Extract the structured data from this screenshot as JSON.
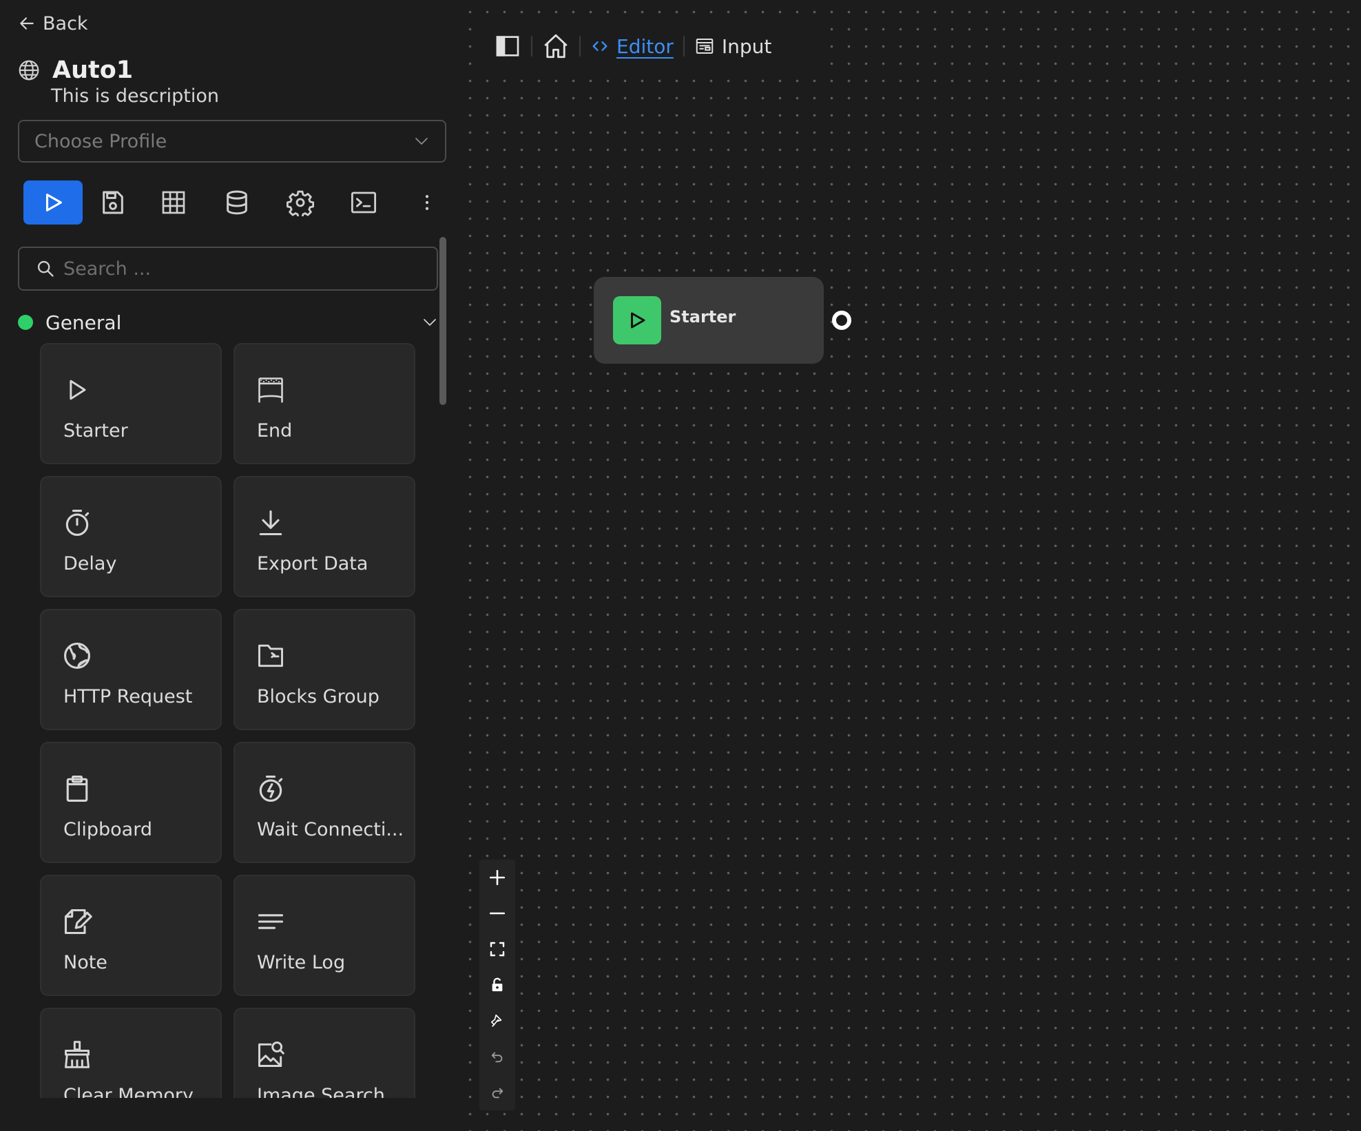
{
  "sidebar": {
    "back_label": "Back",
    "workflow": {
      "title": "Auto1",
      "description": "This is description",
      "icon": "globe-icon"
    },
    "profile_select": {
      "placeholder": "Choose Profile",
      "value": ""
    },
    "toolbar": {
      "items": [
        {
          "name": "run",
          "icon": "play-icon",
          "active": true
        },
        {
          "name": "save",
          "icon": "save-icon"
        },
        {
          "name": "table",
          "icon": "table-icon"
        },
        {
          "name": "storage",
          "icon": "database-icon"
        },
        {
          "name": "settings",
          "icon": "gear-icon"
        },
        {
          "name": "terminal",
          "icon": "terminal-icon"
        },
        {
          "name": "more",
          "icon": "more-vertical-icon"
        }
      ],
      "accent_color": "#1f6de8"
    },
    "search": {
      "placeholder": "Search ...",
      "value": ""
    },
    "category": {
      "label": "General",
      "dot_color": "#2fcf6a",
      "expanded": true,
      "blocks": [
        {
          "label": "Starter",
          "icon": "play-icon"
        },
        {
          "label": "End",
          "icon": "flag-icon"
        },
        {
          "label": "Delay",
          "icon": "stopwatch-icon"
        },
        {
          "label": "Export Data",
          "icon": "download-icon"
        },
        {
          "label": "HTTP Request",
          "icon": "globe-icon"
        },
        {
          "label": "Blocks Group",
          "icon": "folder-icon"
        },
        {
          "label": "Clipboard",
          "icon": "clipboard-icon"
        },
        {
          "label": "Wait Connecti...",
          "icon": "timer-bolt-icon"
        },
        {
          "label": "Note",
          "icon": "note-edit-icon"
        },
        {
          "label": "Write Log",
          "icon": "lines-icon"
        },
        {
          "label": "Clear Memory",
          "icon": "broom-icon"
        },
        {
          "label": "Image Search",
          "icon": "image-search-icon"
        }
      ]
    }
  },
  "canvas": {
    "nav": {
      "tabs": [
        {
          "label": "Editor",
          "icon": "code-icon",
          "active": true
        },
        {
          "label": "Input",
          "icon": "form-icon",
          "active": false
        }
      ]
    },
    "node": {
      "label": "Starter",
      "icon": "play-icon",
      "color": "#3ec86b"
    },
    "controls": [
      "zoom-in",
      "zoom-out",
      "fit-view",
      "lock",
      "clear",
      "undo",
      "redo"
    ]
  }
}
